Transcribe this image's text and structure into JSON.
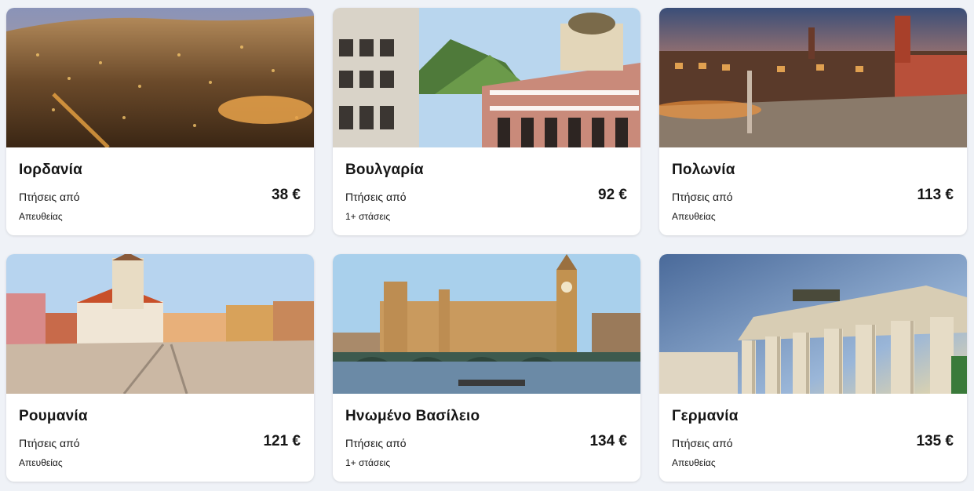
{
  "cards": [
    {
      "destination": "Ιορδανία",
      "from_label": "Πτήσεις από",
      "price": "38 €",
      "stops": "Απευθείας",
      "image": "amman-city-photo"
    },
    {
      "destination": "Βουλγαρία",
      "from_label": "Πτήσεις από",
      "price": "92 €",
      "stops": "1+ στάσεις",
      "image": "rila-monastery-photo"
    },
    {
      "destination": "Πολωνία",
      "from_label": "Πτήσεις από",
      "price": "113 €",
      "stops": "Απευθείας",
      "image": "warsaw-castle-square-photo"
    },
    {
      "destination": "Ρουμανία",
      "from_label": "Πτήσεις από",
      "price": "121 €",
      "stops": "Απευθείας",
      "image": "brasov-council-square-photo"
    },
    {
      "destination": "Ηνωμένο Βασίλειο",
      "from_label": "Πτήσεις από",
      "price": "134 €",
      "stops": "1+ στάσεις",
      "image": "london-westminster-photo"
    },
    {
      "destination": "Γερμανία",
      "from_label": "Πτήσεις από",
      "price": "135 €",
      "stops": "Απευθείας",
      "image": "brandenburg-gate-photo"
    }
  ],
  "colors": {
    "page_background": "#eff2f7",
    "card_background": "#ffffff",
    "text": "#161616"
  }
}
